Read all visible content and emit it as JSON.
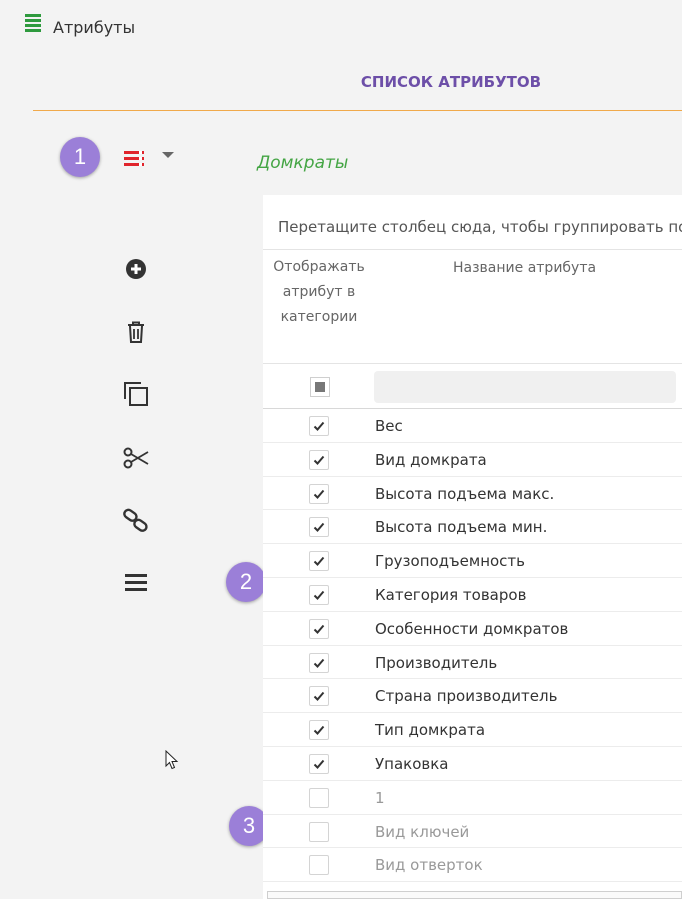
{
  "header": {
    "title": "Атрибуты",
    "icon": "list-icon"
  },
  "page": {
    "section_title": "СПИСОК АТРИБУТОВ",
    "category_name": "Домкраты"
  },
  "badges": [
    "1",
    "2",
    "3"
  ],
  "toolbar": {
    "items": [
      {
        "name": "add-icon"
      },
      {
        "name": "trash-icon"
      },
      {
        "name": "copy-icon"
      },
      {
        "name": "scissors-icon"
      },
      {
        "name": "link-icon"
      },
      {
        "name": "menu-icon"
      }
    ]
  },
  "grid": {
    "group_panel_text": "Перетащите столбец сюда, чтобы группировать по э",
    "columns": {
      "show": "Отображать атрибут в категории",
      "name": "Название атрибута"
    },
    "filter": {
      "placeholder": ""
    },
    "rows": [
      {
        "name": "Вес",
        "checked": true
      },
      {
        "name": "Вид домкрата",
        "checked": true
      },
      {
        "name": "Высота подъема макс.",
        "checked": true
      },
      {
        "name": "Высота подъема мин.",
        "checked": true
      },
      {
        "name": "Грузоподъемность",
        "checked": true
      },
      {
        "name": "Категория товаров",
        "checked": true
      },
      {
        "name": "Особенности домкратов",
        "checked": true
      },
      {
        "name": "Производитель",
        "checked": true
      },
      {
        "name": "Страна производитель",
        "checked": true
      },
      {
        "name": "Тип домкрата",
        "checked": true
      },
      {
        "name": "Упаковка",
        "checked": true
      },
      {
        "name": "1",
        "checked": false
      },
      {
        "name": "Вид ключей",
        "checked": false
      },
      {
        "name": "Вид отверток",
        "checked": false
      }
    ]
  },
  "colors": {
    "accent_purple": "#6d4fa8",
    "badge_purple": "#9b7fd8",
    "category_green": "#44a544",
    "rule_orange": "#f0a94b",
    "icon_red": "#e0242b"
  }
}
